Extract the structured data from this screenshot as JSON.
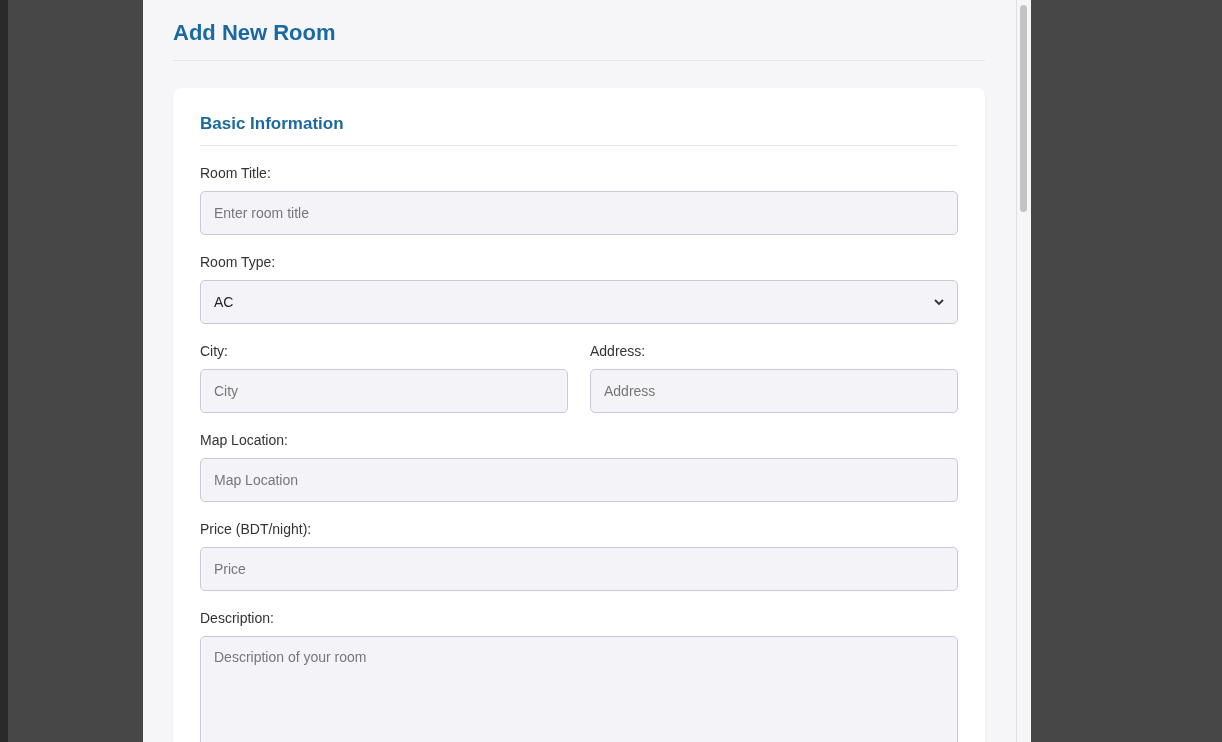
{
  "page": {
    "title": "Add New Room"
  },
  "section": {
    "title": "Basic Information"
  },
  "fields": [
    {
      "kind": "text",
      "label": "Room Title:",
      "placeholder": "Enter room title"
    },
    {
      "kind": "select",
      "label": "Room Type:",
      "value": "AC"
    },
    {
      "kind": "pair",
      "items": [
        {
          "kind": "text",
          "label": "City:",
          "placeholder": "City"
        },
        {
          "kind": "text",
          "label": "Address:",
          "placeholder": "Address"
        }
      ]
    },
    {
      "kind": "text",
      "label": "Map Location:",
      "placeholder": "Map Location"
    },
    {
      "kind": "text",
      "label": "Price (BDT/night):",
      "placeholder": "Price"
    },
    {
      "kind": "textarea",
      "label": "Description:",
      "placeholder": "Description of your room"
    }
  ]
}
